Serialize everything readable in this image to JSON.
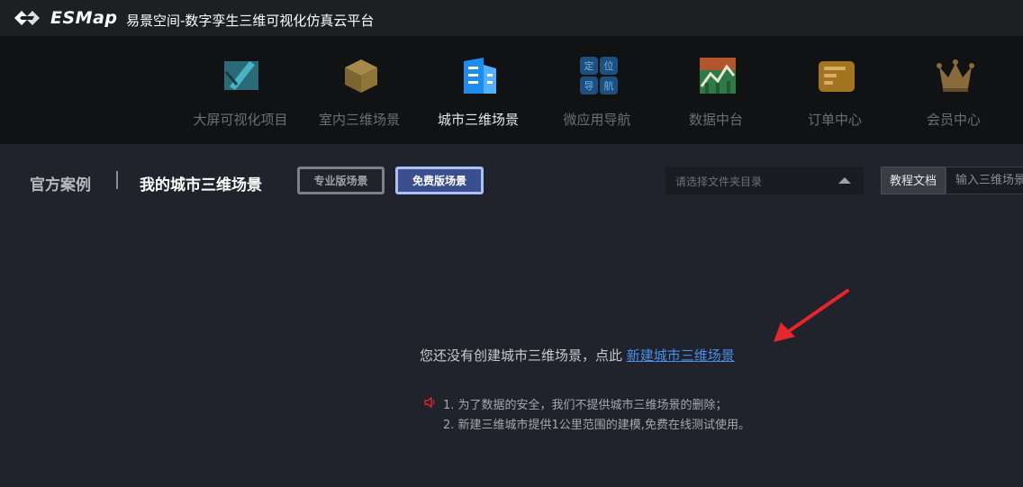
{
  "titlebar": {
    "brand": "ESMap",
    "app_title": "易景空间-数字孪生三维可视化仿真云平台"
  },
  "nav": {
    "items": [
      {
        "label": "大屏可视化项目",
        "icon": "dashboard-icon"
      },
      {
        "label": "室内三维场景",
        "icon": "cube-icon"
      },
      {
        "label": "城市三维场景",
        "icon": "city-building-icon"
      },
      {
        "label": "微应用导航",
        "icon": "navigation-grid-icon",
        "glyphs": [
          "定",
          "位",
          "导",
          "航"
        ]
      },
      {
        "label": "数据中台",
        "icon": "chart-icon"
      },
      {
        "label": "订单中心",
        "icon": "order-icon"
      },
      {
        "label": "会员中心",
        "icon": "crown-icon"
      }
    ],
    "active_index": 2
  },
  "toolbar": {
    "tab_official": "官方案例",
    "tab_mine": "我的城市三维场景",
    "pill_pro": "专业版场景",
    "pill_free": "免费版场景",
    "folder_placeholder": "请选择文件夹目录",
    "tutorial": "教程文档",
    "search_placeholder": "输入三维场景"
  },
  "empty": {
    "message": "您还没有创建城市三维场景，点此 ",
    "link": "新建城市三维场景",
    "notes": [
      "1. 为了数据的安全，我们不提供城市三维场景的删除；",
      "2. 新建三维城市提供1公里范围的建模,免费在线测试使用。"
    ]
  },
  "colors": {
    "accent_link": "#4a8ee8",
    "active_pill_border": "#a9c2f5",
    "arrow": "#e5262b"
  }
}
